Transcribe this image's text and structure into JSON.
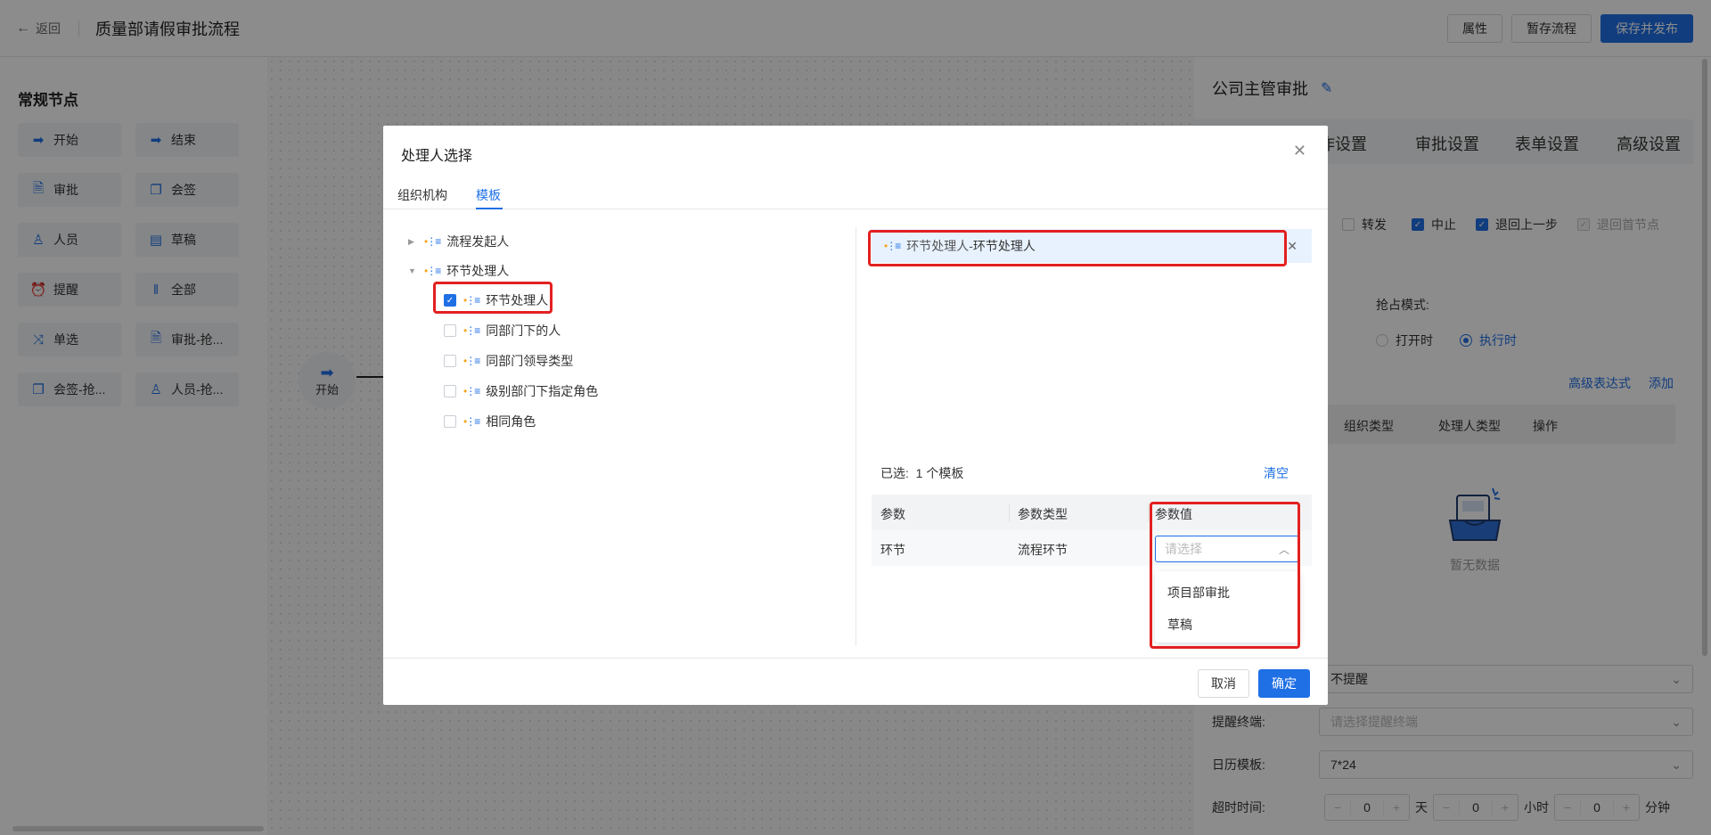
{
  "topbar": {
    "back_label": "返回",
    "title": "质量部请假审批流程",
    "btn_properties": "属性",
    "btn_save_draft": "暂存流程",
    "btn_save_publish": "保存并发布"
  },
  "left_panel": {
    "title": "常规节点",
    "nodes": [
      "开始",
      "结束",
      "审批",
      "会签",
      "人员",
      "草稿",
      "提醒",
      "全部",
      "单选",
      "审批-抢...",
      "会签-抢...",
      "人员-抢..."
    ]
  },
  "canvas": {
    "start_node_label": "开始"
  },
  "right_panel": {
    "title": "公司主管审批",
    "tabs": [
      "作设置",
      "审批设置",
      "表单设置",
      "高级设置"
    ],
    "checks": [
      "转发",
      "中止",
      "退回上一步",
      "退回首节点"
    ],
    "grab_mode_label": "抢占模式:",
    "radio_open": "打开时",
    "radio_exec": "执行时",
    "link_adv_expr": "高级表达式",
    "link_add": "添加",
    "table_headers": [
      "组织类型",
      "处理人类型",
      "操作"
    ],
    "empty_text": "暂无数据",
    "remind_value": "不提醒",
    "remind_end_label": "提醒终端:",
    "remind_end_placeholder": "请选择提醒终端",
    "calendar_label": "日历模板:",
    "calendar_value": "7*24",
    "timeout_label": "超时时间:",
    "timeout_days": "0",
    "unit_day": "天",
    "timeout_hours": "0",
    "unit_hour": "小时",
    "timeout_minutes": "0",
    "unit_minute": "分钟"
  },
  "dialog": {
    "title": "处理人选择",
    "tabs": [
      "组织机构",
      "模板"
    ],
    "tree": {
      "root1": "流程发起人",
      "root2": "环节处理人",
      "children": [
        "环节处理人",
        "同部门下的人",
        "同部门领导类型",
        "级别部门下指定角色",
        "相同角色"
      ]
    },
    "selected_chip_prefix": "环节处理人-",
    "selected_chip_name": "环节处理人",
    "summary_label": "已选:",
    "summary_count": "1 个模板",
    "clear_label": "清空",
    "param_headers": [
      "参数",
      "参数类型",
      "参数值"
    ],
    "param_row": [
      "环节",
      "流程环节"
    ],
    "param_placeholder": "请选择",
    "dropdown_options": [
      "项目部审批",
      "草稿"
    ],
    "btn_cancel": "取消",
    "btn_ok": "确定"
  },
  "colors": {
    "primary": "#1f6fe5",
    "highlight_red": "#e32020"
  }
}
